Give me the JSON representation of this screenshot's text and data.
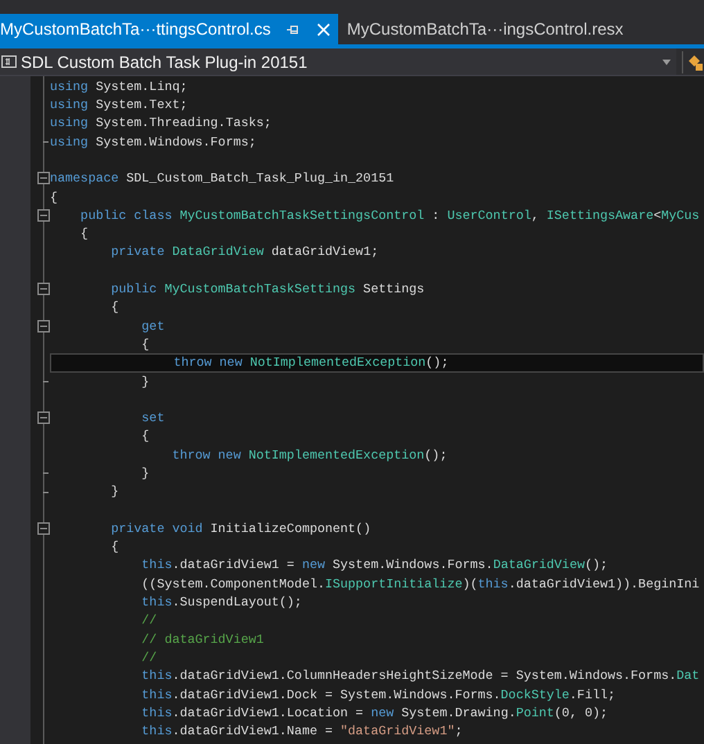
{
  "tabs": [
    {
      "label": "MyCustomBatchTa···ttingsControl.cs",
      "selected": true
    },
    {
      "label": "MyCustomBatchTa···ingsControl.resx",
      "selected": false
    }
  ],
  "navigation_bar": {
    "project": "SDL Custom Batch Task Plug-in 20151"
  },
  "editor": {
    "lines": [
      {
        "collapsible": false,
        "block_end": false,
        "current": false,
        "tokens": [
          {
            "kind": "keyword",
            "text": "using"
          },
          {
            "kind": "plain",
            "text": " System.Linq;"
          }
        ]
      },
      {
        "collapsible": false,
        "block_end": false,
        "current": false,
        "tokens": [
          {
            "kind": "keyword",
            "text": "using"
          },
          {
            "kind": "plain",
            "text": " System.Text;"
          }
        ]
      },
      {
        "collapsible": false,
        "block_end": false,
        "current": false,
        "tokens": [
          {
            "kind": "keyword",
            "text": "using"
          },
          {
            "kind": "plain",
            "text": " System.Threading.Tasks;"
          }
        ]
      },
      {
        "collapsible": false,
        "block_end": true,
        "current": false,
        "tokens": [
          {
            "kind": "keyword",
            "text": "using"
          },
          {
            "kind": "plain",
            "text": " System.Windows.Forms;"
          }
        ]
      },
      {
        "collapsible": false,
        "block_end": false,
        "current": false
      },
      {
        "collapsible": true,
        "block_end": false,
        "current": false,
        "tokens": [
          {
            "kind": "keyword",
            "text": "namespace"
          },
          {
            "kind": "plain",
            "text": " SDL_Custom_Batch_Task_Plug_in_20151"
          }
        ]
      },
      {
        "collapsible": false,
        "block_end": false,
        "current": false,
        "tokens": [
          {
            "kind": "plain",
            "text": "{"
          }
        ]
      },
      {
        "collapsible": true,
        "block_end": false,
        "current": false,
        "tokens": [
          {
            "kind": "keyword",
            "text": "    public class "
          },
          {
            "kind": "type",
            "text": "MyCustomBatchTaskSettingsControl"
          },
          {
            "kind": "plain",
            "text": " : "
          },
          {
            "kind": "type",
            "text": "UserControl"
          },
          {
            "kind": "plain",
            "text": ", "
          },
          {
            "kind": "type",
            "text": "ISettingsAware"
          },
          {
            "kind": "plain",
            "text": "<"
          },
          {
            "kind": "type",
            "text": "MyCus"
          }
        ]
      },
      {
        "collapsible": false,
        "block_end": false,
        "current": false,
        "tokens": [
          {
            "kind": "plain",
            "text": "    {"
          }
        ]
      },
      {
        "collapsible": false,
        "block_end": false,
        "current": false,
        "tokens": [
          {
            "kind": "keyword",
            "text": "        private "
          },
          {
            "kind": "type",
            "text": "DataGridView"
          },
          {
            "kind": "plain",
            "text": " dataGridView1;"
          }
        ]
      },
      {
        "collapsible": false,
        "block_end": false,
        "current": false
      },
      {
        "collapsible": true,
        "block_end": false,
        "current": false,
        "tokens": [
          {
            "kind": "keyword",
            "text": "        public "
          },
          {
            "kind": "type",
            "text": "MyCustomBatchTaskSettings"
          },
          {
            "kind": "plain",
            "text": " Settings"
          }
        ]
      },
      {
        "collapsible": false,
        "block_end": false,
        "current": false,
        "tokens": [
          {
            "kind": "plain",
            "text": "        {"
          }
        ]
      },
      {
        "collapsible": true,
        "block_end": false,
        "current": false,
        "tokens": [
          {
            "kind": "keyword",
            "text": "            get"
          }
        ]
      },
      {
        "collapsible": false,
        "block_end": false,
        "current": false,
        "tokens": [
          {
            "kind": "plain",
            "text": "            {"
          }
        ]
      },
      {
        "collapsible": false,
        "block_end": false,
        "current": true,
        "tokens": [
          {
            "kind": "keyword",
            "text": "                throw new "
          },
          {
            "kind": "type",
            "text": "NotImplementedException"
          },
          {
            "kind": "plain",
            "text": "();"
          }
        ]
      },
      {
        "collapsible": false,
        "block_end": true,
        "current": false,
        "tokens": [
          {
            "kind": "plain",
            "text": "            }"
          }
        ]
      },
      {
        "collapsible": false,
        "block_end": false,
        "current": false
      },
      {
        "collapsible": true,
        "block_end": false,
        "current": false,
        "tokens": [
          {
            "kind": "keyword",
            "text": "            set"
          }
        ]
      },
      {
        "collapsible": false,
        "block_end": false,
        "current": false,
        "tokens": [
          {
            "kind": "plain",
            "text": "            {"
          }
        ]
      },
      {
        "collapsible": false,
        "block_end": false,
        "current": false,
        "tokens": [
          {
            "kind": "keyword",
            "text": "                throw new "
          },
          {
            "kind": "type",
            "text": "NotImplementedException"
          },
          {
            "kind": "plain",
            "text": "();"
          }
        ]
      },
      {
        "collapsible": false,
        "block_end": true,
        "current": false,
        "tokens": [
          {
            "kind": "plain",
            "text": "            }"
          }
        ]
      },
      {
        "collapsible": false,
        "block_end": true,
        "current": false,
        "tokens": [
          {
            "kind": "plain",
            "text": "        }"
          }
        ]
      },
      {
        "collapsible": false,
        "block_end": false,
        "current": false
      },
      {
        "collapsible": true,
        "block_end": false,
        "current": false,
        "tokens": [
          {
            "kind": "keyword",
            "text": "        private void "
          },
          {
            "kind": "plain",
            "text": "InitializeComponent()"
          }
        ]
      },
      {
        "collapsible": false,
        "block_end": false,
        "current": false,
        "tokens": [
          {
            "kind": "plain",
            "text": "        {"
          }
        ]
      },
      {
        "collapsible": false,
        "block_end": false,
        "current": false,
        "tokens": [
          {
            "kind": "keyword",
            "text": "            this"
          },
          {
            "kind": "plain",
            "text": ".dataGridView1 = "
          },
          {
            "kind": "keyword",
            "text": "new "
          },
          {
            "kind": "plain",
            "text": "System.Windows.Forms."
          },
          {
            "kind": "type",
            "text": "DataGridView"
          },
          {
            "kind": "plain",
            "text": "();"
          }
        ]
      },
      {
        "collapsible": false,
        "block_end": false,
        "current": false,
        "tokens": [
          {
            "kind": "plain",
            "text": "            ((System.ComponentModel."
          },
          {
            "kind": "type",
            "text": "ISupportInitialize"
          },
          {
            "kind": "plain",
            "text": ")("
          },
          {
            "kind": "keyword",
            "text": "this"
          },
          {
            "kind": "plain",
            "text": ".dataGridView1)).BeginIni"
          }
        ]
      },
      {
        "collapsible": false,
        "block_end": false,
        "current": false,
        "tokens": [
          {
            "kind": "keyword",
            "text": "            this"
          },
          {
            "kind": "plain",
            "text": ".SuspendLayout();"
          }
        ]
      },
      {
        "collapsible": false,
        "block_end": false,
        "current": false,
        "tokens": [
          {
            "kind": "comment",
            "text": "            //"
          }
        ]
      },
      {
        "collapsible": false,
        "block_end": false,
        "current": false,
        "tokens": [
          {
            "kind": "comment",
            "text": "            // dataGridView1"
          }
        ]
      },
      {
        "collapsible": false,
        "block_end": false,
        "current": false,
        "tokens": [
          {
            "kind": "comment",
            "text": "            //"
          }
        ]
      },
      {
        "collapsible": false,
        "block_end": false,
        "current": false,
        "tokens": [
          {
            "kind": "keyword",
            "text": "            this"
          },
          {
            "kind": "plain",
            "text": ".dataGridView1.ColumnHeadersHeightSizeMode = System.Windows.Forms."
          },
          {
            "kind": "type",
            "text": "Dat"
          }
        ]
      },
      {
        "collapsible": false,
        "block_end": false,
        "current": false,
        "tokens": [
          {
            "kind": "keyword",
            "text": "            this"
          },
          {
            "kind": "plain",
            "text": ".dataGridView1.Dock = System.Windows.Forms."
          },
          {
            "kind": "type",
            "text": "DockStyle"
          },
          {
            "kind": "plain",
            "text": ".Fill;"
          }
        ]
      },
      {
        "collapsible": false,
        "block_end": false,
        "current": false,
        "tokens": [
          {
            "kind": "keyword",
            "text": "            this"
          },
          {
            "kind": "plain",
            "text": ".dataGridView1.Location = "
          },
          {
            "kind": "keyword",
            "text": "new "
          },
          {
            "kind": "plain",
            "text": "System.Drawing."
          },
          {
            "kind": "type",
            "text": "Point"
          },
          {
            "kind": "plain",
            "text": "(0, 0);"
          }
        ]
      },
      {
        "collapsible": false,
        "block_end": false,
        "current": false,
        "tokens": [
          {
            "kind": "keyword",
            "text": "            this"
          },
          {
            "kind": "plain",
            "text": ".dataGridView1.Name = "
          },
          {
            "kind": "string",
            "text": "\"dataGridView1\""
          },
          {
            "kind": "plain",
            "text": ";"
          }
        ]
      }
    ]
  }
}
